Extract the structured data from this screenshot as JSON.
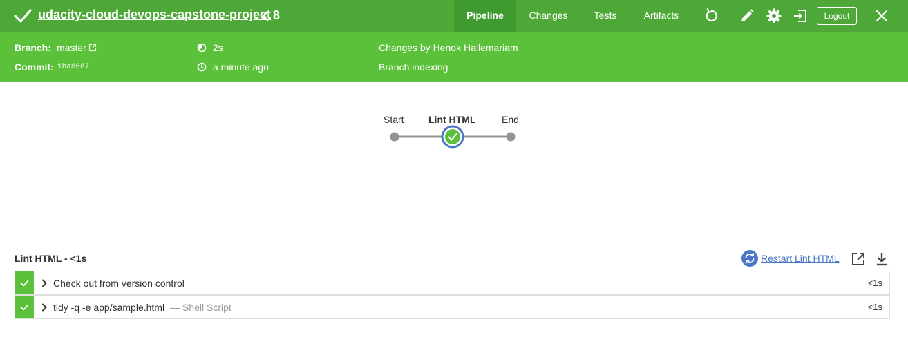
{
  "header": {
    "title": "udacity-cloud-devops-capstone-project",
    "run_number": "8",
    "tabs": [
      {
        "label": "Pipeline",
        "active": true
      },
      {
        "label": "Changes",
        "active": false
      },
      {
        "label": "Tests",
        "active": false
      },
      {
        "label": "Artifacts",
        "active": false
      }
    ],
    "logout_label": "Logout",
    "status": "success",
    "colors": {
      "header": "#4da838",
      "details": "#5cc13a",
      "active_tab": "#3f9a2f"
    }
  },
  "details": {
    "branch_label": "Branch:",
    "branch_value": "master",
    "commit_label": "Commit:",
    "commit_value": "1ba8687",
    "duration": "2s",
    "time_ago": "a minute ago",
    "changes_by": "Changes by Henok Hailemariam",
    "cause": "Branch indexing"
  },
  "pipeline_graph": {
    "nodes": [
      {
        "label": "Start",
        "type": "terminal"
      },
      {
        "label": "Lint HTML",
        "type": "stage",
        "status": "success",
        "selected": true
      },
      {
        "label": "End",
        "type": "terminal"
      }
    ]
  },
  "stage": {
    "title": "Lint HTML - <1s",
    "restart_label": "Restart Lint HTML",
    "steps": [
      {
        "text": "Check out from version control",
        "desc": "",
        "duration": "<1s",
        "status": "success"
      },
      {
        "text": "tidy -q -e app/sample.html",
        "desc": "— Shell Script",
        "duration": "<1s",
        "status": "success"
      }
    ]
  }
}
